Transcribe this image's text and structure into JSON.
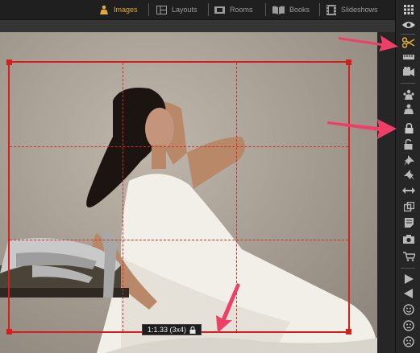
{
  "top_tabs": [
    {
      "label": "Images",
      "icon": "person-icon",
      "active": true
    },
    {
      "label": "Layouts",
      "icon": "layout-icon",
      "active": false
    },
    {
      "label": "Rooms",
      "icon": "rooms-icon",
      "active": false
    },
    {
      "label": "Books",
      "icon": "book-icon",
      "active": false
    },
    {
      "label": "Slideshows",
      "icon": "filmstrip-icon",
      "active": false
    }
  ],
  "crop": {
    "ratio_label": "1:1.33 (3x4)",
    "ratio_lock_icon": "lock-icon"
  },
  "toolbar_icons": [
    "grid-icon",
    "eye-icon",
    "scissors-icon",
    "filmstrip-icon",
    "video-icon",
    "person-group-icon",
    "person-icon",
    "lock-icon",
    "unlock-icon",
    "pin-icon",
    "pin-tilt-icon",
    "move-horizontal-icon",
    "copy-icon",
    "note-icon",
    "camera-icon",
    "cart-icon",
    "play-icon",
    "play-back-icon",
    "smile-icon",
    "neutral-face-icon",
    "sad-face-icon"
  ],
  "colors": {
    "accent": "#e0a93a",
    "crop_border": "#d3201c",
    "annotation_arrow": "#ef3f66"
  }
}
